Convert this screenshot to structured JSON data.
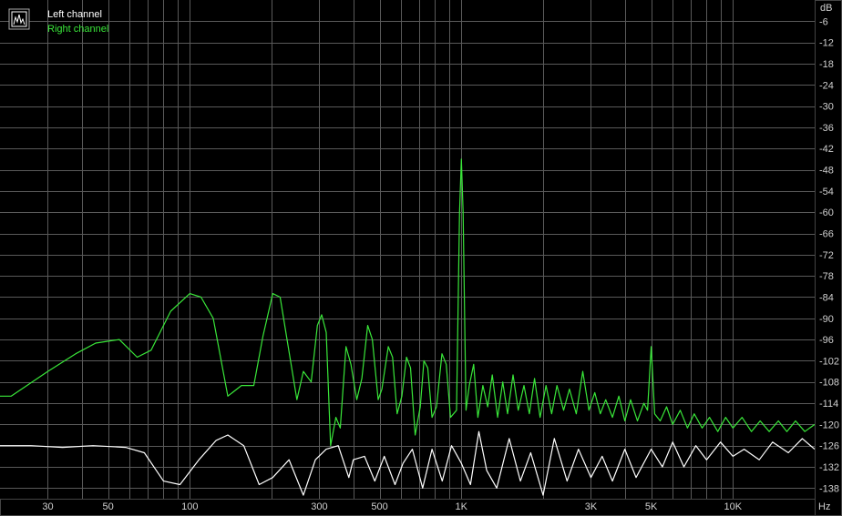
{
  "chart_data": {
    "type": "line",
    "x_scale": "log",
    "xlim": [
      20,
      20000
    ],
    "ylim": [
      -141,
      0
    ],
    "grid": true,
    "legend_position": "top-left",
    "ylabel": "dB",
    "xlabel": "Hz",
    "y_ticks": [
      -6,
      -12,
      -18,
      -24,
      -30,
      -36,
      -42,
      -48,
      -54,
      -60,
      -66,
      -72,
      -78,
      -84,
      -90,
      -96,
      -102,
      -108,
      -114,
      -120,
      -126,
      -132,
      -138
    ],
    "x_ticks": [
      {
        "v": 30,
        "label": "30"
      },
      {
        "v": 50,
        "label": "50"
      },
      {
        "v": 100,
        "label": "100"
      },
      {
        "v": 300,
        "label": "300"
      },
      {
        "v": 500,
        "label": "500"
      },
      {
        "v": 1000,
        "label": "1K"
      },
      {
        "v": 3000,
        "label": "3K"
      },
      {
        "v": 5000,
        "label": "5K"
      },
      {
        "v": 10000,
        "label": "10K"
      }
    ],
    "series": [
      {
        "name": "Left channel",
        "color": "#ffffff",
        "points": [
          [
            20,
            -126
          ],
          [
            26,
            -126
          ],
          [
            34,
            -126.5
          ],
          [
            44,
            -126
          ],
          [
            58,
            -126.5
          ],
          [
            68,
            -128
          ],
          [
            80,
            -136
          ],
          [
            92,
            -137
          ],
          [
            108,
            -130
          ],
          [
            125,
            -124.5
          ],
          [
            138,
            -123
          ],
          [
            158,
            -126
          ],
          [
            180,
            -137
          ],
          [
            202,
            -135
          ],
          [
            232,
            -130
          ],
          [
            262,
            -140
          ],
          [
            290,
            -130
          ],
          [
            318,
            -127
          ],
          [
            352,
            -126
          ],
          [
            385,
            -135
          ],
          [
            400,
            -130
          ],
          [
            440,
            -129
          ],
          [
            480,
            -136
          ],
          [
            520,
            -129
          ],
          [
            570,
            -137
          ],
          [
            610,
            -131
          ],
          [
            660,
            -127
          ],
          [
            720,
            -138
          ],
          [
            780,
            -127
          ],
          [
            850,
            -136
          ],
          [
            920,
            -126
          ],
          [
            1000,
            -131
          ],
          [
            1080,
            -137
          ],
          [
            1160,
            -122
          ],
          [
            1240,
            -133
          ],
          [
            1350,
            -138
          ],
          [
            1500,
            -124
          ],
          [
            1650,
            -136
          ],
          [
            1800,
            -128
          ],
          [
            2000,
            -140
          ],
          [
            2200,
            -124
          ],
          [
            2450,
            -136
          ],
          [
            2700,
            -127
          ],
          [
            3000,
            -135
          ],
          [
            3300,
            -129
          ],
          [
            3600,
            -136
          ],
          [
            4000,
            -127
          ],
          [
            4400,
            -135
          ],
          [
            5000,
            -127
          ],
          [
            5500,
            -132
          ],
          [
            6000,
            -125
          ],
          [
            6600,
            -132
          ],
          [
            7300,
            -126
          ],
          [
            8000,
            -130
          ],
          [
            9000,
            -125
          ],
          [
            10000,
            -129
          ],
          [
            11000,
            -127
          ],
          [
            12500,
            -130
          ],
          [
            14000,
            -125
          ],
          [
            16000,
            -128
          ],
          [
            18000,
            -124
          ],
          [
            20000,
            -127
          ]
        ]
      },
      {
        "name": "Right channel",
        "color": "#39e639",
        "points": [
          [
            20,
            -112
          ],
          [
            22,
            -112
          ],
          [
            30,
            -105
          ],
          [
            38,
            -100
          ],
          [
            45,
            -97
          ],
          [
            55,
            -96
          ],
          [
            64,
            -101
          ],
          [
            72,
            -99
          ],
          [
            85,
            -88
          ],
          [
            100,
            -83
          ],
          [
            110,
            -84
          ],
          [
            122,
            -90
          ],
          [
            138,
            -112
          ],
          [
            155,
            -109
          ],
          [
            172,
            -109
          ],
          [
            186,
            -95
          ],
          [
            202,
            -83
          ],
          [
            215,
            -84
          ],
          [
            228,
            -96
          ],
          [
            248,
            -113
          ],
          [
            262,
            -105
          ],
          [
            280,
            -108
          ],
          [
            295,
            -92
          ],
          [
            306,
            -89
          ],
          [
            318,
            -94
          ],
          [
            330,
            -126
          ],
          [
            345,
            -118
          ],
          [
            358,
            -121
          ],
          [
            376,
            -98
          ],
          [
            392,
            -103
          ],
          [
            412,
            -113
          ],
          [
            430,
            -107
          ],
          [
            452,
            -92
          ],
          [
            470,
            -96
          ],
          [
            494,
            -113
          ],
          [
            510,
            -110
          ],
          [
            538,
            -98
          ],
          [
            558,
            -101
          ],
          [
            580,
            -117
          ],
          [
            604,
            -112
          ],
          [
            628,
            -101
          ],
          [
            650,
            -104
          ],
          [
            676,
            -123
          ],
          [
            706,
            -115
          ],
          [
            728,
            -102
          ],
          [
            752,
            -104
          ],
          [
            780,
            -118
          ],
          [
            810,
            -115
          ],
          [
            848,
            -100
          ],
          [
            880,
            -103
          ],
          [
            912,
            -118
          ],
          [
            960,
            -116
          ],
          [
            985,
            -60
          ],
          [
            1000,
            -45
          ],
          [
            1015,
            -60
          ],
          [
            1040,
            -116
          ],
          [
            1070,
            -109
          ],
          [
            1110,
            -103
          ],
          [
            1150,
            -118
          ],
          [
            1200,
            -109
          ],
          [
            1250,
            -115
          ],
          [
            1300,
            -106
          ],
          [
            1360,
            -118
          ],
          [
            1420,
            -108
          ],
          [
            1480,
            -117
          ],
          [
            1550,
            -106
          ],
          [
            1620,
            -116
          ],
          [
            1700,
            -109
          ],
          [
            1780,
            -117
          ],
          [
            1860,
            -107
          ],
          [
            1950,
            -118
          ],
          [
            2050,
            -109
          ],
          [
            2150,
            -117
          ],
          [
            2250,
            -109
          ],
          [
            2380,
            -116
          ],
          [
            2500,
            -110
          ],
          [
            2650,
            -117
          ],
          [
            2800,
            -105
          ],
          [
            2950,
            -116
          ],
          [
            3100,
            -111
          ],
          [
            3250,
            -117
          ],
          [
            3400,
            -113
          ],
          [
            3600,
            -118
          ],
          [
            3800,
            -112
          ],
          [
            4000,
            -119
          ],
          [
            4200,
            -113
          ],
          [
            4450,
            -119
          ],
          [
            4700,
            -114
          ],
          [
            4850,
            -116
          ],
          [
            5000,
            -98
          ],
          [
            5150,
            -117
          ],
          [
            5400,
            -119
          ],
          [
            5700,
            -115
          ],
          [
            6000,
            -120
          ],
          [
            6400,
            -116
          ],
          [
            6800,
            -121
          ],
          [
            7200,
            -117
          ],
          [
            7700,
            -121
          ],
          [
            8200,
            -118
          ],
          [
            8800,
            -122
          ],
          [
            9400,
            -118
          ],
          [
            10000,
            -121
          ],
          [
            10800,
            -118
          ],
          [
            11700,
            -122
          ],
          [
            12600,
            -119
          ],
          [
            13600,
            -122
          ],
          [
            14700,
            -119
          ],
          [
            15800,
            -122
          ],
          [
            17000,
            -119
          ],
          [
            18400,
            -122
          ],
          [
            20000,
            -120
          ]
        ]
      }
    ]
  }
}
